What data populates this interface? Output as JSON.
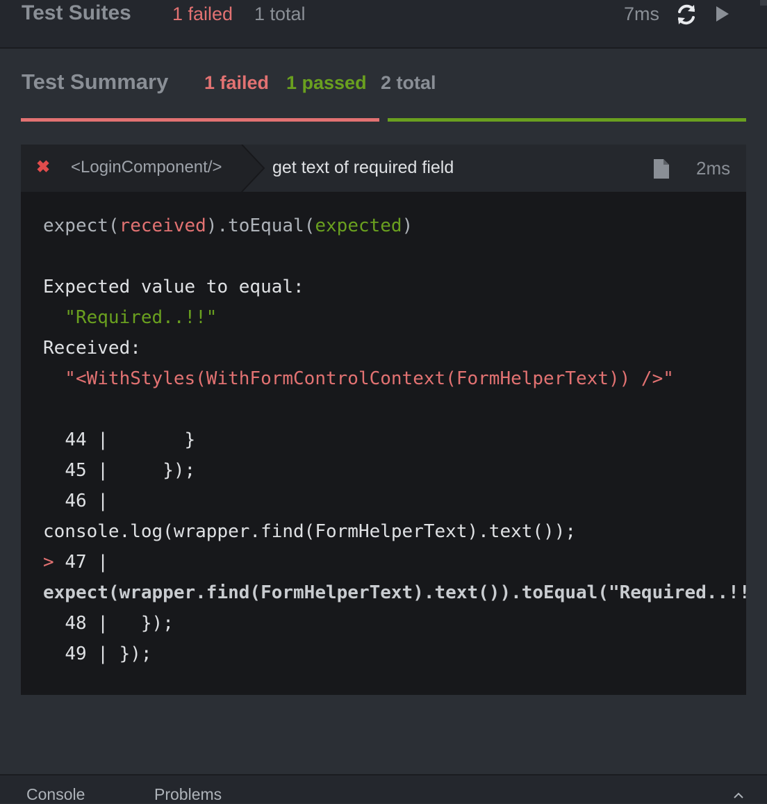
{
  "suites": {
    "title": "Test Suites",
    "failed": "1 failed",
    "total": "1 total",
    "time": "7ms"
  },
  "summary": {
    "title": "Test Summary",
    "failed": "1 failed",
    "passed": "1 passed",
    "total": "2 total"
  },
  "test": {
    "component": "<LoginComponent/>",
    "name": "get text of required field",
    "duration": "2ms",
    "status": "failed"
  },
  "error": {
    "expect_fn": "expect(",
    "received_word": "received",
    "to_equal": ").toEqual(",
    "expected_word": "expected",
    "close_paren": ")",
    "expected_label": "Expected value to equal:",
    "expected_value": "  \"Required..!!\"",
    "received_label": "Received:",
    "received_value": "  \"<WithStyles(WithFormControlContext(FormHelperText)) />\""
  },
  "code_frame": [
    {
      "prefix": "  ",
      "number": "44",
      "code": " |       }"
    },
    {
      "prefix": "  ",
      "number": "45",
      "code": " |     });"
    },
    {
      "prefix": "  ",
      "number": "46",
      "code": " |"
    },
    {
      "prefix": "",
      "number": "",
      "code": "console.log(wrapper.find(FormHelperText).text());"
    },
    {
      "prefix": "> ",
      "number": "47",
      "code": " |"
    },
    {
      "prefix": "",
      "number": "",
      "code": "expect(wrapper.find(FormHelperText).text()).toEqual(\"Required..!!\");"
    },
    {
      "prefix": "  ",
      "number": "48",
      "code": " |   });"
    },
    {
      "prefix": "  ",
      "number": "49",
      "code": " | });"
    }
  ],
  "bottom_tabs": {
    "console": "Console",
    "problems": "Problems"
  },
  "colors": {
    "failed": "#e27272",
    "passed": "#6aa01f",
    "background": "#2b2f35"
  },
  "icons": {
    "refresh": "refresh-icon",
    "play": "play-icon",
    "fail": "close-icon",
    "file": "file-icon",
    "chevron": "chevron-up-icon"
  }
}
